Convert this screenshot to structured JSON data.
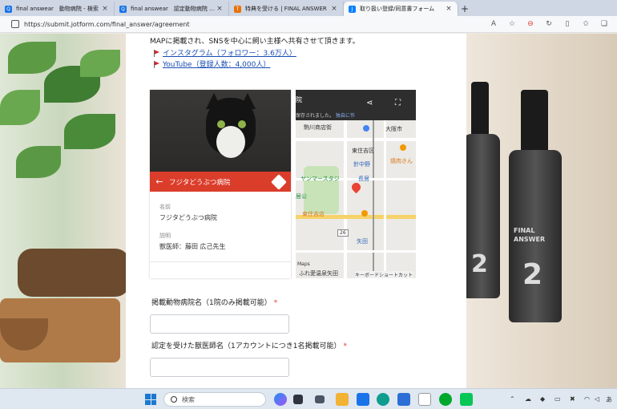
{
  "browser": {
    "tabs": [
      {
        "title": "final answear　動物病院 - 検索",
        "icon": "search-favicon",
        "color": "#1a73e8",
        "active": false
      },
      {
        "title": "final answear　認定動物病院 - 検索",
        "icon": "search-favicon",
        "color": "#1a73e8",
        "active": false
      },
      {
        "title": "特典を受ける | FINAL ANSWER",
        "icon": "brand-favicon",
        "color": "#e8710a",
        "active": false
      },
      {
        "title": "取り扱い登録/同意書フォーム",
        "icon": "jotform-favicon",
        "color": "#0a80ff",
        "active": true
      }
    ],
    "close_glyph": "×",
    "new_tab_glyph": "+",
    "url": "https://submit.jotform.com/final_answer/agreement"
  },
  "form": {
    "intro_text": "MAPに掲載され、SNSを中心に飼い主様へ共有させて頂きます。",
    "links": [
      {
        "text": "インスタグラム（フォロワー：3.6万人）"
      },
      {
        "text": "YouTube（登録人数：4,000人）"
      }
    ],
    "map_card": {
      "place_name": "フジタどうぶつ病院",
      "name_label": "名前",
      "name_value": "フジタどうぶつ病院",
      "desc_label": "説明",
      "desc_value": "獣医師：藤田 広己先生",
      "map_title": "院",
      "map_sub": "保存されました。",
      "map_sub_link": "独自に作",
      "labels": {
        "l1": "駒川商店街",
        "l2": "大阪市",
        "l3": "東住吉区",
        "l4": "針中野",
        "l5": "焼肉きん",
        "l6": "ヤンマースタジ",
        "l7": "長居",
        "l8": "東住吉店",
        "l9": "矢田",
        "l10": "ふれ愛温泉矢田",
        "l11": "キーボードショートカット",
        "l12": "居公",
        "l13": "26",
        "l14": "Maps"
      }
    },
    "questions": [
      {
        "label": "掲載動物病院名（1院のみ掲載可能）",
        "required_mark": "*",
        "value": ""
      },
      {
        "label": "認定を受けた獣医師名（1アカウントにつき1名掲載可能）",
        "required_mark": "*",
        "value": ""
      }
    ]
  },
  "background": {
    "bottle_label_1": "FINAL ANSWER",
    "bottle_number": "2"
  },
  "taskbar": {
    "search_placeholder": "検索",
    "tray_lang": "あ"
  }
}
